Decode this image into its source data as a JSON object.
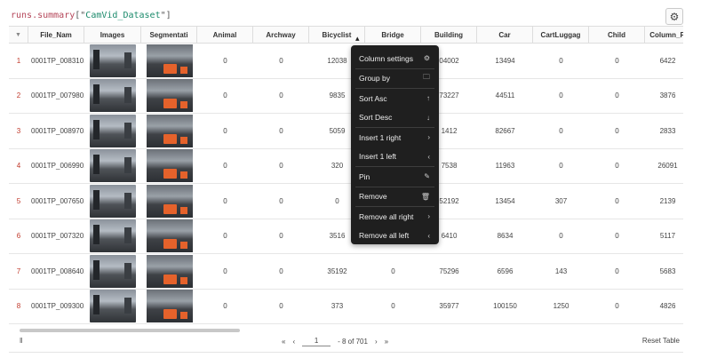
{
  "query": {
    "object": "runs.summary",
    "open": "[\"",
    "key": "CamVid_Dataset",
    "close": "\"]"
  },
  "toolbar": {
    "settings_icon": "gear-icon"
  },
  "columns": [
    "File_Nam",
    "Images",
    "Segmentati",
    "Animal",
    "Archway",
    "Bicyclist",
    "Bridge",
    "Building",
    "Car",
    "CartLuggag",
    "Child",
    "Column_P"
  ],
  "rows": [
    {
      "idx": "1",
      "file": "0001TP_008310.",
      "animal": "0",
      "archway": "0",
      "bicyclist": "12038",
      "bridge": "",
      "building": "04002",
      "car": "13494",
      "cart": "0",
      "child": "0",
      "column": "6422"
    },
    {
      "idx": "2",
      "file": "0001TP_007980.",
      "animal": "0",
      "archway": "0",
      "bicyclist": "9835",
      "bridge": "",
      "building": "73227",
      "car": "44511",
      "cart": "0",
      "child": "0",
      "column": "3876"
    },
    {
      "idx": "3",
      "file": "0001TP_008970.",
      "animal": "0",
      "archway": "0",
      "bicyclist": "5059",
      "bridge": "",
      "building": "1412",
      "car": "82667",
      "cart": "0",
      "child": "0",
      "column": "2833"
    },
    {
      "idx": "4",
      "file": "0001TP_006990.",
      "animal": "0",
      "archway": "0",
      "bicyclist": "320",
      "bridge": "",
      "building": "7538",
      "car": "11963",
      "cart": "0",
      "child": "0",
      "column": "26091"
    },
    {
      "idx": "5",
      "file": "0001TP_007650.",
      "animal": "0",
      "archway": "0",
      "bicyclist": "0",
      "bridge": "",
      "building": "52192",
      "car": "13454",
      "cart": "307",
      "child": "0",
      "column": "2139"
    },
    {
      "idx": "6",
      "file": "0001TP_007320.",
      "animal": "0",
      "archway": "0",
      "bicyclist": "3516",
      "bridge": "",
      "building": "6410",
      "car": "8634",
      "cart": "0",
      "child": "0",
      "column": "5117"
    },
    {
      "idx": "7",
      "file": "0001TP_008640.",
      "animal": "0",
      "archway": "0",
      "bicyclist": "35192",
      "bridge": "0",
      "building": "75296",
      "car": "6596",
      "cart": "143",
      "child": "0",
      "column": "5683"
    },
    {
      "idx": "8",
      "file": "0001TP_009300.",
      "animal": "0",
      "archway": "0",
      "bicyclist": "373",
      "bridge": "0",
      "building": "35977",
      "car": "100150",
      "cart": "1250",
      "child": "0",
      "column": "4826"
    }
  ],
  "menu": [
    {
      "label": "Column settings",
      "icon": "⚙"
    },
    {
      "label": "Group by",
      "icon": "🗀"
    },
    {
      "label": "Sort Asc",
      "icon": "↑"
    },
    {
      "label": "Sort Desc",
      "icon": "↓"
    },
    {
      "label": "Insert 1 right",
      "icon": "›"
    },
    {
      "label": "Insert 1 left",
      "icon": "‹"
    },
    {
      "label": "Pin",
      "icon": "✎"
    },
    {
      "label": "Remove",
      "icon": "🗑"
    },
    {
      "label": "Remove all right",
      "icon": "›"
    },
    {
      "label": "Remove all left",
      "icon": "‹"
    }
  ],
  "footer": {
    "first": "«",
    "prev": "‹",
    "page": "1",
    "range": "- 8 of 701",
    "next": "›",
    "last": "»",
    "reset": "Reset Table",
    "left_mark": "‖"
  }
}
